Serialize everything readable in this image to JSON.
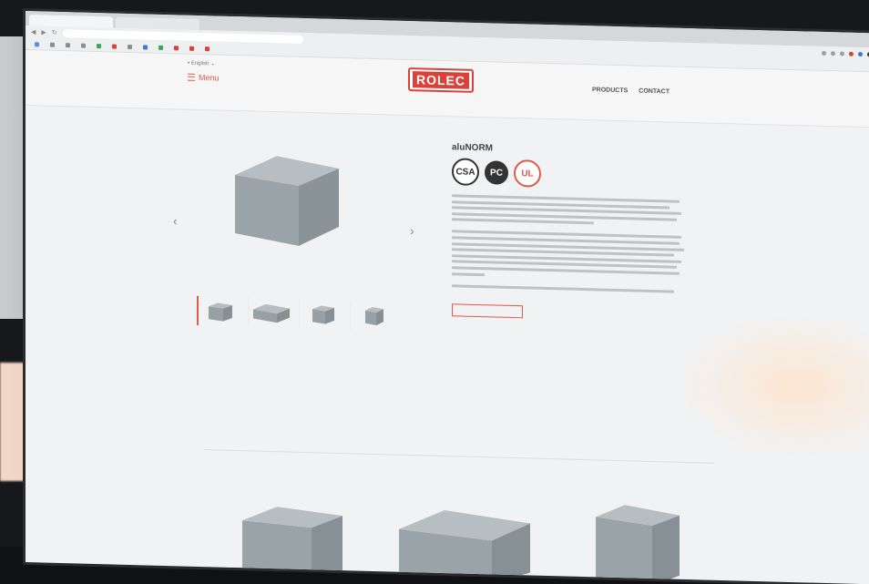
{
  "browser": {
    "tabs": [
      "",
      ""
    ],
    "url": "",
    "bookmarks": [
      "",
      "",
      "",
      "",
      "",
      "",
      "",
      "",
      "",
      "",
      "",
      ""
    ]
  },
  "site": {
    "language": "English",
    "menu_label": "Menu",
    "logo_text": "ROLEC",
    "util_links": [
      "",
      "",
      ""
    ],
    "main_links": [
      "PRODUCTS",
      "CONTACT"
    ]
  },
  "breadcrumb": "",
  "product": {
    "title": "aluNORM",
    "subtitle": "",
    "certifications": [
      "CSA",
      "PC",
      "UL"
    ],
    "rating": "",
    "image_caption": "",
    "cta_label": ""
  },
  "tabs": [
    "",
    "",
    "",
    "",
    "",
    "",
    "",
    ""
  ],
  "variants": [
    "",
    "",
    ""
  ],
  "colors": {
    "brand_red": "#d9413a",
    "accent": "#e05a4a",
    "enclosure_grey": "#9ea7ab"
  }
}
